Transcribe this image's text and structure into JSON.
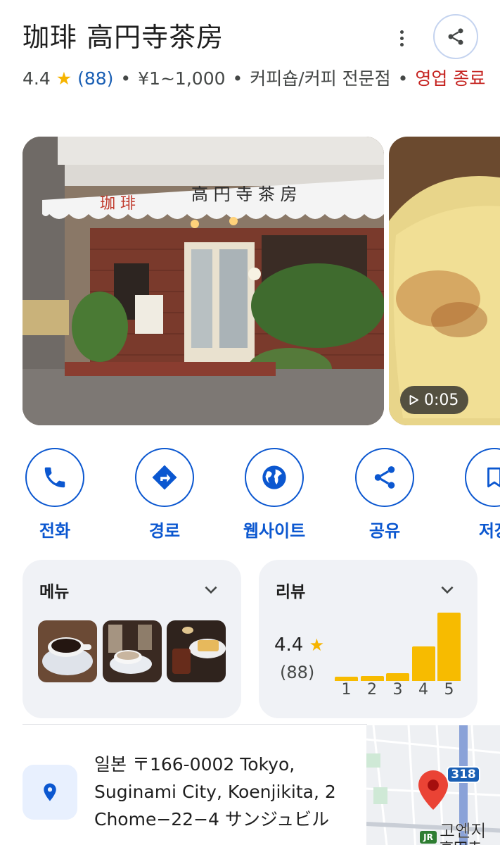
{
  "place": {
    "name": "珈琲 高円寺茶房",
    "rating": "4.4",
    "review_count": "(88)",
    "price": "¥1~1,000",
    "category": "커피숍/커피 전문점",
    "status": "영업 종료"
  },
  "header_icons": {
    "more": "more-vert-icon",
    "share": "share-icon"
  },
  "media": {
    "video_duration": "0:05"
  },
  "actions": [
    {
      "label": "전화",
      "icon": "phone-icon"
    },
    {
      "label": "경로",
      "icon": "directions-icon"
    },
    {
      "label": "웹사이트",
      "icon": "globe-icon"
    },
    {
      "label": "공유",
      "icon": "share-icon"
    },
    {
      "label": "저장",
      "icon": "bookmark-icon"
    }
  ],
  "menu_card": {
    "title": "메뉴"
  },
  "review_card": {
    "title": "리뷰",
    "rating": "4.4",
    "count": "(88)",
    "distribution": {
      "labels": [
        "1",
        "2",
        "3",
        "4",
        "5"
      ],
      "values": [
        0.06,
        0.07,
        0.11,
        0.48,
        0.95
      ]
    }
  },
  "address": {
    "line1": "일본 〒166-0002 Tokyo,",
    "line2": "Suginami City, Koenjikita, 2",
    "line3": "Chome−22−4 サンジュビル"
  },
  "map": {
    "route_number": "318",
    "station_label": "고엔지",
    "station_sub": "高円寺",
    "rail_badge": "JR"
  },
  "colors": {
    "accent": "#0b57d0",
    "star": "#f6b400",
    "closed": "#c5221f",
    "bar": "#f7bb00",
    "card_bg": "#f0f2f6"
  }
}
